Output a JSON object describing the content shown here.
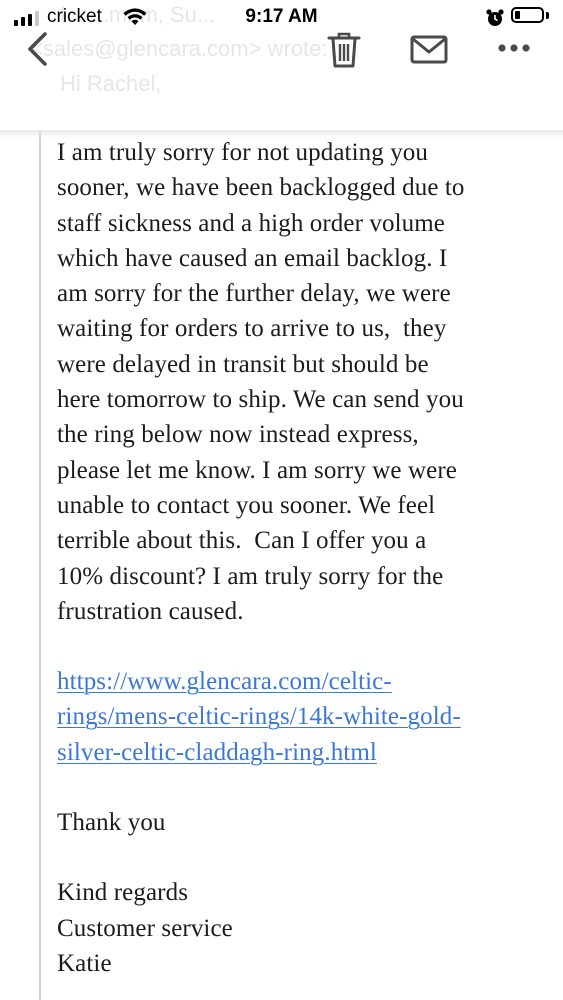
{
  "status_bar": {
    "carrier": "cricket",
    "time": "9:17 AM",
    "signal_bars_on": 3,
    "battery_level": 0.2
  },
  "header_ghost": {
    "line1": "I... ...mom, Su...",
    "line2": "<sales@glencara.com> wrote:",
    "line3": "Hi Rachel,"
  },
  "toolbar": {
    "back": "chevron-left-icon",
    "trash": "trash-icon",
    "reply": "envelope-icon",
    "more": "more-icon"
  },
  "email": {
    "lines": [
      "I am truly sorry for not updating you",
      "sooner, we have been backlogged due to",
      "staff sickness and a high order volume",
      "which have caused an email backlog. I",
      "am sorry for the further delay, we were",
      "waiting for orders to arrive to us,  they",
      "were delayed in transit but should be",
      "here tomorrow to ship. We can send you",
      "the ring below now instead express,",
      "please let me know. I am sorry we were",
      "unable to contact you sooner. We feel",
      "terrible about this.  Can I offer you a",
      "10% discount? I am truly sorry for the",
      "frustration caused."
    ],
    "link_lines": [
      "https://www.glencara.com/celtic-",
      "rings/mens-celtic-rings/14k-white-gold-",
      "silver-celtic-claddagh-ring.html"
    ],
    "thanks": "Thank you",
    "regards": "Kind regards",
    "team": "Customer service",
    "signature": "Katie"
  },
  "colors": {
    "link": "#3b77d8",
    "icon": "#4a4a4a"
  }
}
